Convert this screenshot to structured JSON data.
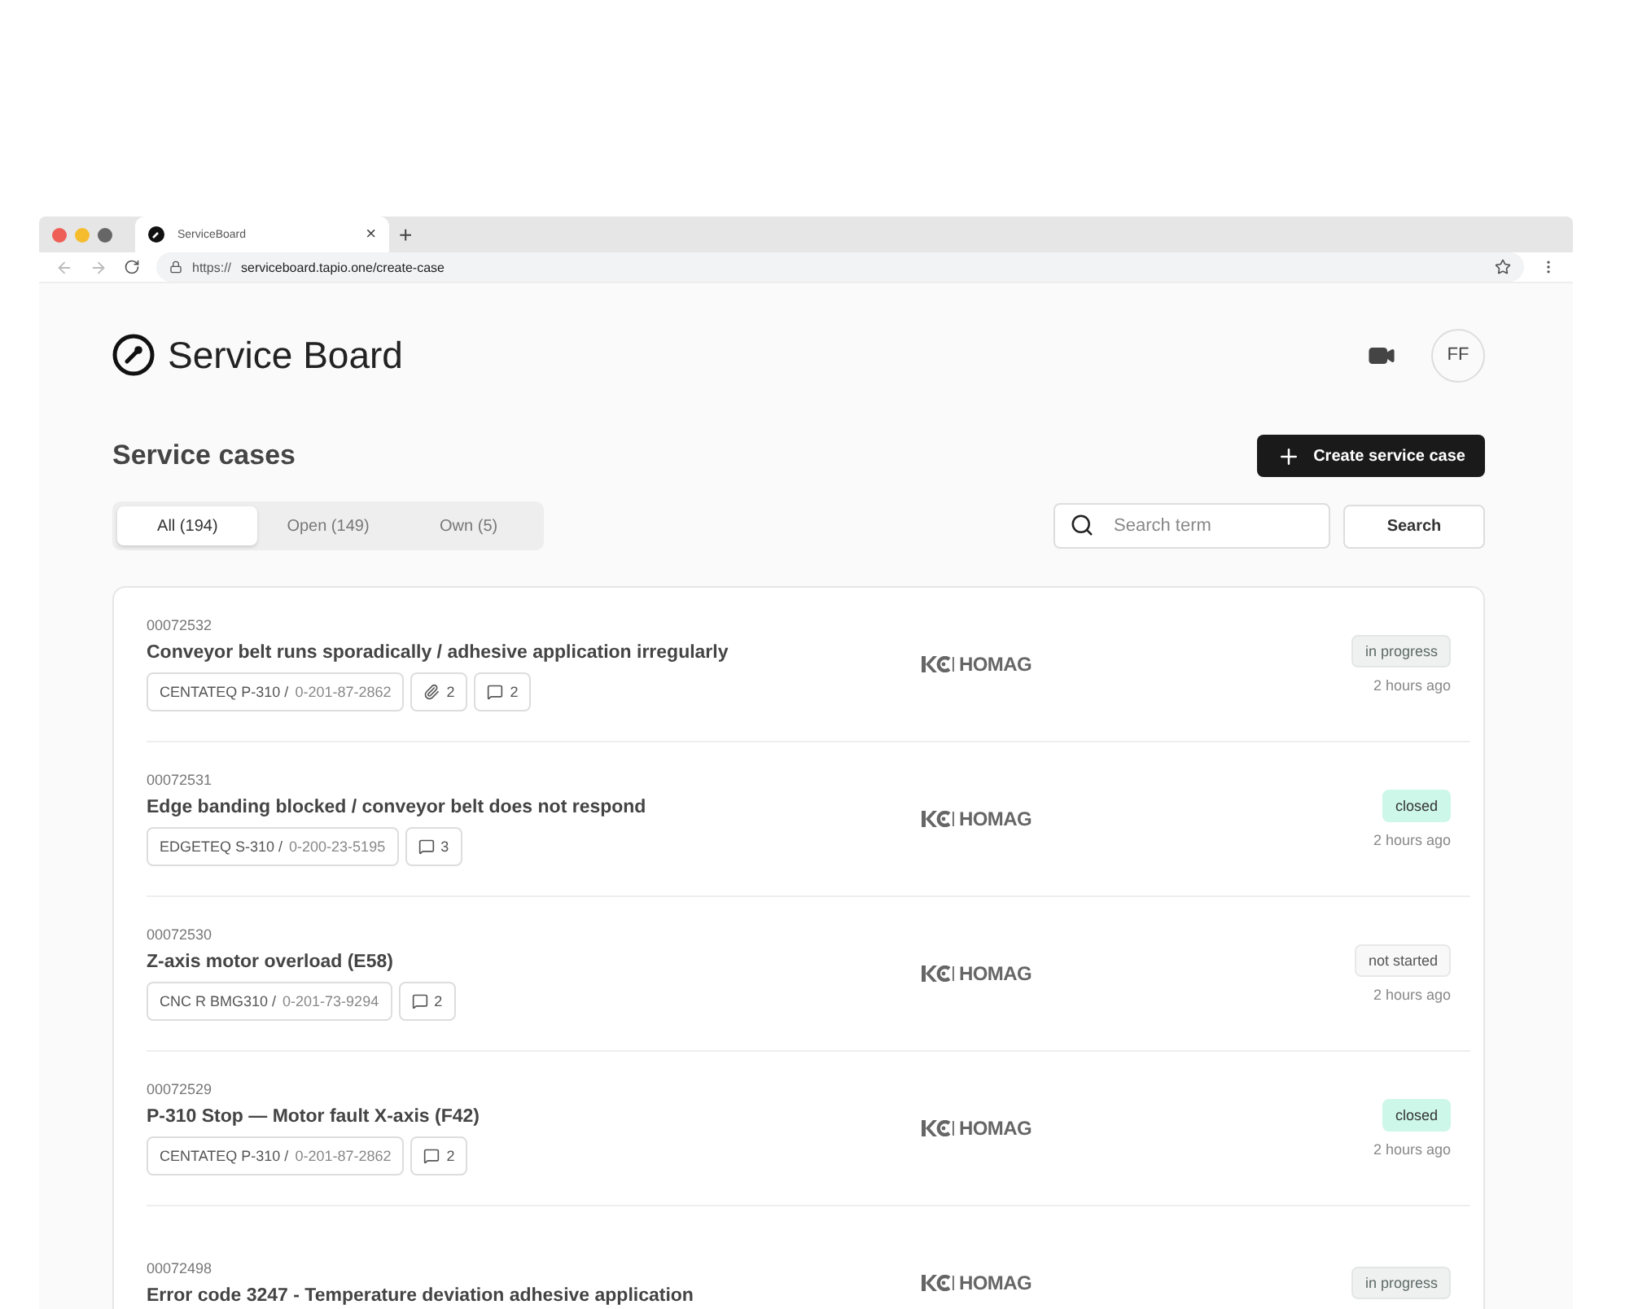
{
  "browser": {
    "tab_title": "ServiceBoard",
    "tab_close": "×",
    "new_tab": "+",
    "url_scheme": "https://",
    "url_path": "serviceboard.tapio.one/create-case"
  },
  "header": {
    "title": "Service Board",
    "avatar": "FF"
  },
  "section": {
    "title": "Service cases",
    "create_button": "Create service case"
  },
  "filters": [
    {
      "label": "All (194)",
      "selected": true
    },
    {
      "label": "Open (149)",
      "selected": false
    },
    {
      "label": "Own (5)",
      "selected": false
    }
  ],
  "search": {
    "placeholder": "Search term",
    "button": "Search"
  },
  "cases": [
    {
      "number": "00072532",
      "title": "Conveyor belt runs sporadically / adhesive application irregularly",
      "machine": "CENTATEQ P-310 /",
      "serial": "0-201-87-2862",
      "attachments": "2",
      "comments": "2",
      "brand": "HOMAG",
      "status": "in progress",
      "kind": "in_progress",
      "time": "2 hours ago"
    },
    {
      "number": "00072531",
      "title": "Edge banding blocked / conveyor belt does not respond",
      "machine": "EDGETEQ S-310 /",
      "serial": "0-200-23-5195",
      "comments": "3",
      "brand": "HOMAG",
      "status": "closed",
      "kind": "closed",
      "time": "2 hours ago"
    },
    {
      "number": "00072530",
      "title": "Z-axis motor overload (E58)",
      "machine": "CNC R BMG310 /",
      "serial": "0-201-73-9294",
      "comments": "2",
      "brand": "HOMAG",
      "status": "not started",
      "kind": "not_started",
      "time": "2 hours ago"
    },
    {
      "number": "00072529",
      "title": "P-310 Stop — Motor fault X-axis (F42)",
      "machine": "CENTATEQ P-310 /",
      "serial": "0-201-87-2862",
      "comments": "2",
      "brand": "HOMAG",
      "status": "closed",
      "kind": "closed",
      "time": "2 hours ago"
    },
    {
      "number": "00072498",
      "title": "Error code 3247 - Temperature deviation adhesive application",
      "brand": "HOMAG",
      "status": "in progress",
      "kind": "in_progress"
    }
  ]
}
